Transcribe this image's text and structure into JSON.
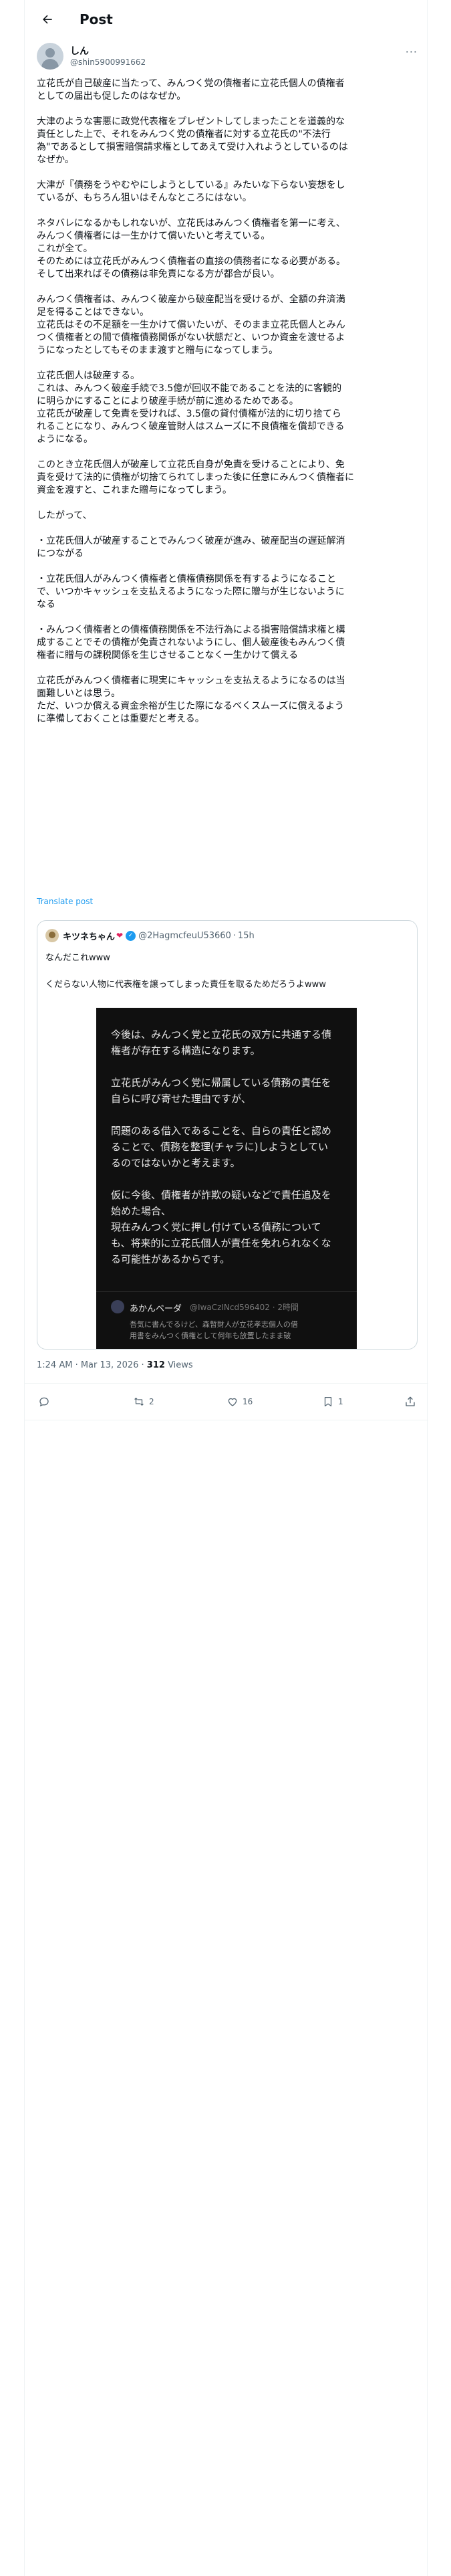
{
  "header": {
    "title": "Post"
  },
  "post": {
    "author_name": "しん",
    "author_handle": "@shin5900991662",
    "more_label": "···",
    "text": "立花氏が自己破産に当たって、みんつく党の債権者に立花氏個人の債権者\nとしての届出も促したのはなぜか。\n\n大津のような害悪に政党代表権をプレゼントしてしまったことを道義的な\n責任とした上で、それをみんつく党の債権者に対する立花氏の\"不法行\n為\"であるとして損害賠償請求権としてあえて受け入れようとしているのは\nなぜか。\n\n大津が『債務をうやむやにしようとしている』みたいな下らない妄想をし\nているが、もちろん狙いはそんなところにはない。\n\nネタバレになるかもしれないが、立花氏はみんつく債権者を第一に考え、\nみんつく債権者には一生かけて償いたいと考えている。\nこれが全て。\nそのためには立花氏がみんつく債権者の直接の債務者になる必要がある。\nそして出来ればその債務は非免責になる方が都合が良い。\n\nみんつく債権者は、みんつく破産から破産配当を受けるが、全額の弁済満\n足を得ることはできない。\n立花氏はその不足額を一生かけて償いたいが、そのまま立花氏個人とみん\nつく債権者との間で債権債務関係がない状態だと、いつか資金を渡せるよ\nうになったとしてもそのまま渡すと贈与になってしまう。\n\n立花氏個人は破産する。\nこれは、みんつく破産手続で3.5億が回収不能であることを法的に客観的\nに明らかにすることにより破産手続が前に進めるためである。\n立花氏が破産して免責を受ければ、3.5億の貸付債権が法的に切り捨てら\nれることになり、みんつく破産管財人はスムーズに不良債権を償却できる\nようになる。\n\nこのとき立花氏個人が破産して立花氏自身が免責を受けることにより、免\n責を受けて法的に債権が切捨てられてしまった後に任意にみんつく債権者に\n資金を渡すと、これまた贈与になってしまう。\n\nしたがって、\n\n・立花氏個人が破産することでみんつく破産が進み、破産配当の遅延解消\nにつながる\n\n・立花氏個人がみんつく債権者と債権債務関係を有するようになること\nで、いつかキャッシュを支払えるようになった際に贈与が生じないように\nなる\n\n・みんつく債権者との債権債務関係を不法行為による損害賠償請求権と構\n成することでその債権が免責されないようにし、個人破産後もみんつく債\n権者に贈与の課税関係を生じさせることなく一生かけて償える\n\n立花氏がみんつく債権者に現実にキャッシュを支払えるようになるのは当\n面難しいとは思う。\nただ、いつか償える資金余裕が生じた際になるべくスムーズに償えるよう\nに準備しておくことは重要だと考える。",
    "translate_label": "Translate post",
    "timestamp": "1:24 AM · Mar 13, 2026",
    "meta_dot": " · ",
    "views_count": "312",
    "views_label": " Views"
  },
  "quote": {
    "name": "キツネちゃん",
    "heart": "❤",
    "verified": "✓",
    "handle": "@2HagmcfeuU53660",
    "dot": "·",
    "time": "15h",
    "line1": "なんだこれwww",
    "line2": "くだらない人物に代表権を譲ってしまった責任を取るためだろうよwww",
    "image_text": "今後は、みんつく党と立花氏の双方に共通する債\n権者が存在する構造になります。\n\n立花氏がみんつく党に帰属している債務の責任を\n自らに呼び寄せた理由ですが、\n\n問題のある借入であることを、自らの責任と認め\nることで、債務を整理(チャラに)しようとしてい\nるのではないかと考えます。\n\n仮に今後、債権者が詐欺の疑いなどで責任追及を\n始めた場合、\n現在みんつく党に押し付けている債務について\nも、将来的に立花氏個人が責任を免れられなくな\nる可能性があるからです。",
    "inner_name": "あかんベーダ",
    "inner_meta": "@IwaCzINcd596402 · 2時間",
    "inner_text": "吾気に書んでるけど、森暫財人が立花孝志個人の借\n用書をみんつく債権として何年も放置したまま破"
  },
  "actions": {
    "reply_count": "",
    "retweet_count": "2",
    "like_count": "16",
    "bookmark_count": "1"
  },
  "colors": {
    "accent": "#1d9bf0",
    "muted": "#536471",
    "border": "#eff3f4"
  }
}
